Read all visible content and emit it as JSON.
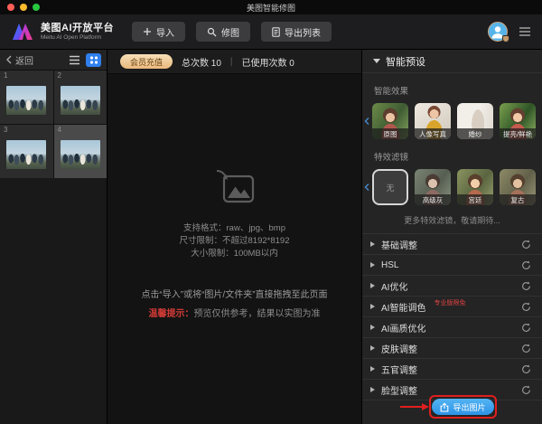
{
  "window": {
    "title": "美图智能修图"
  },
  "toolbar": {
    "brand": {
      "name": "美图AI开放平台",
      "subtitle": "Meitu AI Open Platform"
    },
    "import_label": "导入",
    "retouch_label": "修图",
    "export_list_label": "导出列表"
  },
  "left_panel": {
    "back_label": "返回",
    "thumbnails": [
      {
        "index": "1"
      },
      {
        "index": "2"
      },
      {
        "index": "3"
      },
      {
        "index": "4"
      }
    ]
  },
  "center": {
    "recharge_label": "会员充值",
    "total_label": "总次数 10",
    "divider": "|",
    "used_label": "已使用次数 0",
    "format_line": "支持格式：raw、jpg、bmp",
    "dimension_line": "尺寸限制：不超过8192*8192",
    "size_line": "大小限制：100MB以内",
    "hint_line": "点击“导入”或将“图片/文件夹”直接拖拽至此页面",
    "tip_prefix": "温馨提示：",
    "tip_text": "预览仅供参考，结果以实图为准"
  },
  "right_panel": {
    "preset_header": "智能预设",
    "effects_label": "智能效果",
    "effects": [
      {
        "label": "原图"
      },
      {
        "label": "人像写真"
      },
      {
        "label": "婚纱"
      },
      {
        "label": "提亮/鲜艳"
      }
    ],
    "filters_label": "特效滤镜",
    "filter_none_label": "无",
    "filters": [
      {
        "label": "高级灰"
      },
      {
        "label": "宫廷"
      },
      {
        "label": "复古"
      }
    ],
    "more_filters": "更多特效滤镜，敬请期待...",
    "sections": [
      {
        "label": "基础调整"
      },
      {
        "label": "HSL"
      },
      {
        "label": "AI优化"
      },
      {
        "label": "AI智能调色",
        "badge": "专业版限免"
      },
      {
        "label": "AI画质优化"
      },
      {
        "label": "皮肤调整"
      },
      {
        "label": "五官调整"
      },
      {
        "label": "脸型调整"
      }
    ],
    "export_button_label": "导出图片"
  },
  "colors": {
    "accent_blue": "#2f80ed",
    "export_blue": "#35a0ee",
    "highlight_red": "#e01f1f",
    "vip_tan": "#eec08b"
  }
}
